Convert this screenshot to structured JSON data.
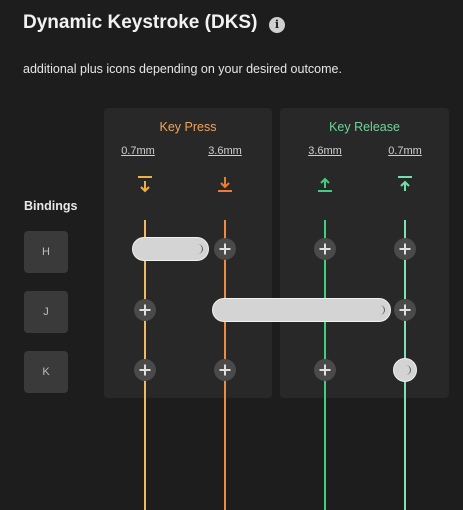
{
  "header": {
    "title": "Dynamic Keystroke (DKS)",
    "info_icon": "info-icon"
  },
  "description": "additional plus icons depending on your desired outcome.",
  "press": {
    "title": "Key Press",
    "color": "#f0a45a",
    "distances": [
      "0.7mm",
      "3.6mm"
    ]
  },
  "release": {
    "title": "Key Release",
    "color": "#6fd39a",
    "distances": [
      "3.6mm",
      "0.7mm"
    ]
  },
  "bindings": {
    "label": "Bindings",
    "keys": [
      "H",
      "J",
      "K"
    ]
  }
}
